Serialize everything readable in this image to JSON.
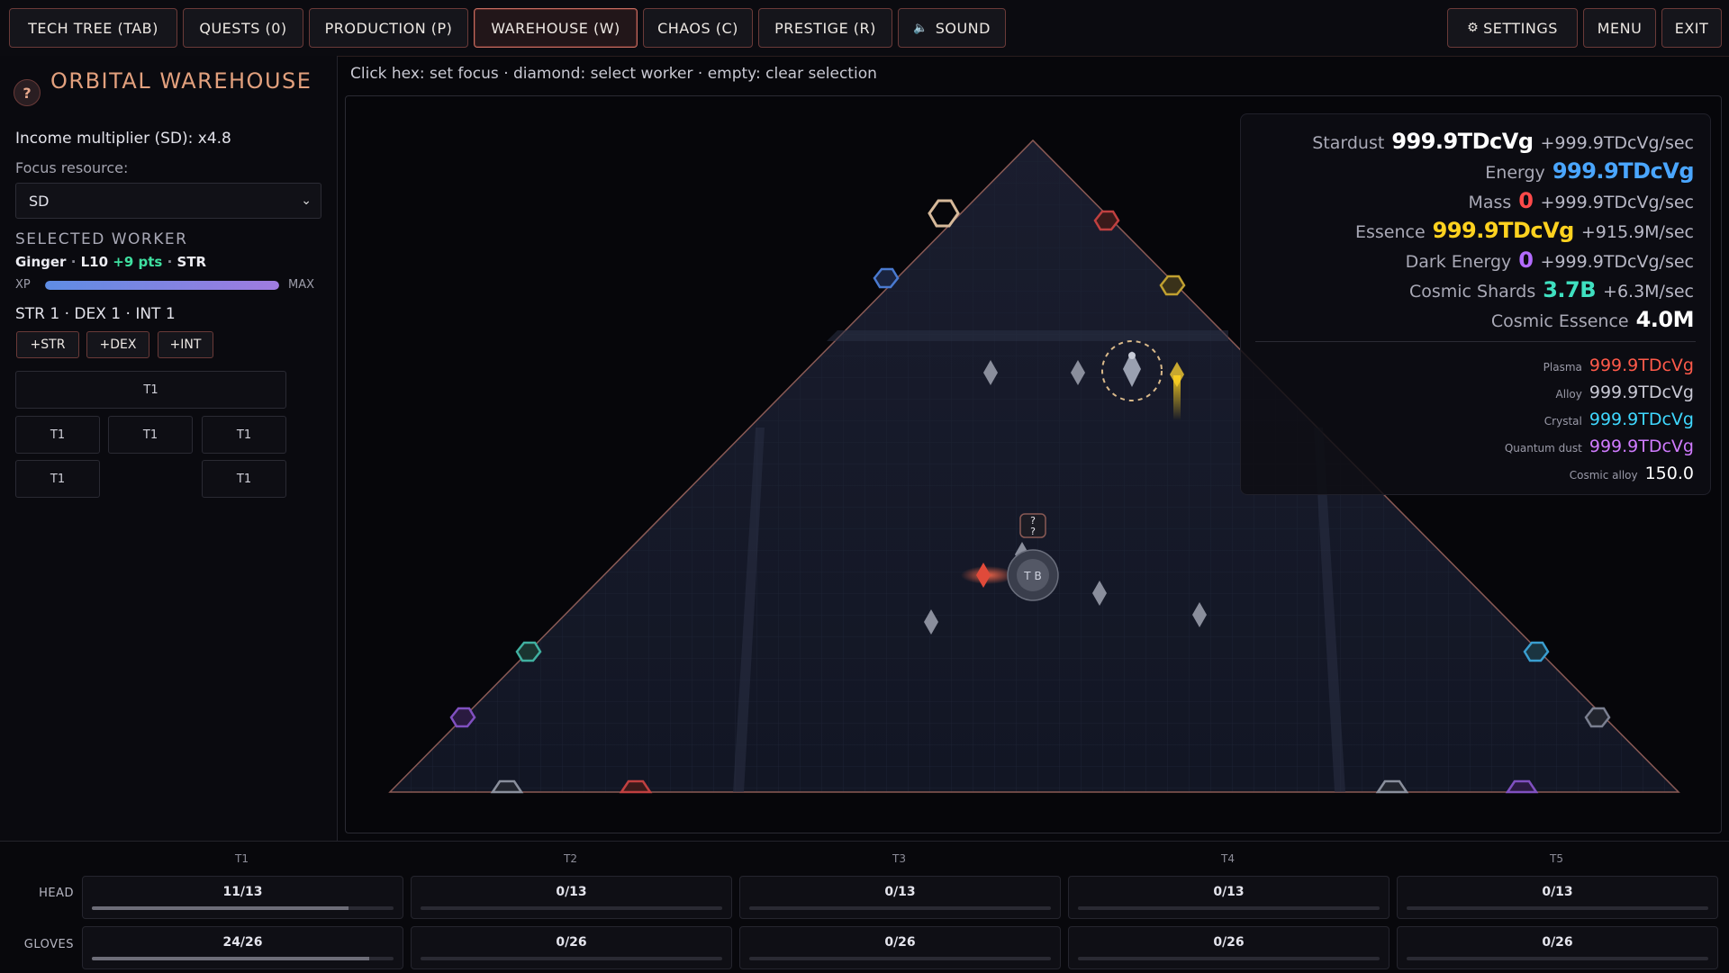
{
  "topnav": {
    "tech_tree": "TECH TREE (TAB)",
    "quests": "QUESTS (0)",
    "production": "PRODUCTION (P)",
    "warehouse": "WAREHOUSE (W)",
    "chaos": "CHAOS (C)",
    "prestige": "PRESTIGE (R)",
    "sound": "SOUND",
    "settings": "SETTINGS",
    "menu": "MENU",
    "exit": "EXIT"
  },
  "left": {
    "help": "?",
    "title": "ORBITAL WAREHOUSE",
    "income": "Income multiplier (SD): x4.8",
    "focus_label": "Focus resource:",
    "focus_value": "SD",
    "selected_title": "SELECTED WORKER",
    "worker_name": "Ginger",
    "worker_level": "L10",
    "worker_points": "+9 pts",
    "worker_stat": "STR",
    "xp_label": "XP",
    "xp_max": "MAX",
    "xp_fraction": 1.0,
    "stats": "STR 1 · DEX 1 · INT 1",
    "add_str": "+STR",
    "add_dex": "+DEX",
    "add_int": "+INT",
    "slots": [
      "T1",
      "T1",
      "T1",
      "T1",
      "T1",
      "T1"
    ]
  },
  "hint": "Click hex: set focus · diamond: select worker · empty: clear selection",
  "resources": {
    "main": [
      {
        "label": "Stardust",
        "value": "999.9TDcVg",
        "rate": "+999.9TDcVg/sec",
        "color": "#ffffff"
      },
      {
        "label": "Energy",
        "value": "999.9TDcVg",
        "rate": "",
        "color": "#4aa6ff"
      },
      {
        "label": "Mass",
        "value": "0",
        "rate": "+999.9TDcVg/sec",
        "color": "#ff4a4a"
      },
      {
        "label": "Essence",
        "value": "999.9TDcVg",
        "rate": "+915.9M/sec",
        "color": "#ffd21f"
      },
      {
        "label": "Dark Energy",
        "value": "0",
        "rate": "+999.9TDcVg/sec",
        "color": "#b36bff"
      },
      {
        "label": "Cosmic Shards",
        "value": "3.7B",
        "rate": "+6.3M/sec",
        "color": "#3fe0c0"
      },
      {
        "label": "Cosmic Essence",
        "value": "4.0M",
        "rate": "",
        "color": "#ffffff"
      }
    ],
    "minor": [
      {
        "label": "Plasma",
        "value": "999.9TDcVg",
        "color": "#ff5a4a"
      },
      {
        "label": "Alloy",
        "value": "999.9TDcVg",
        "color": "#c8c8d4"
      },
      {
        "label": "Crystal",
        "value": "999.9TDcVg",
        "color": "#3fd8ff"
      },
      {
        "label": "Quantum dust",
        "value": "999.9TDcVg",
        "color": "#d07bff"
      },
      {
        "label": "Cosmic alloy",
        "value": "150.0",
        "color": "#ffffff"
      }
    ]
  },
  "arena": {
    "question_badge": "?",
    "question_sub": "?",
    "worker_initials": "T B"
  },
  "gear": {
    "tiers": [
      "T1",
      "T2",
      "T3",
      "T4",
      "T5"
    ],
    "rows": [
      {
        "label": "HEAD",
        "cells": [
          "11/13",
          "0/13",
          "0/13",
          "0/13",
          "0/13"
        ],
        "fill": [
          0.85,
          0,
          0,
          0,
          0
        ]
      },
      {
        "label": "GLOVES",
        "cells": [
          "24/26",
          "0/26",
          "0/26",
          "0/26",
          "0/26"
        ],
        "fill": [
          0.92,
          0,
          0,
          0,
          0
        ]
      }
    ]
  }
}
